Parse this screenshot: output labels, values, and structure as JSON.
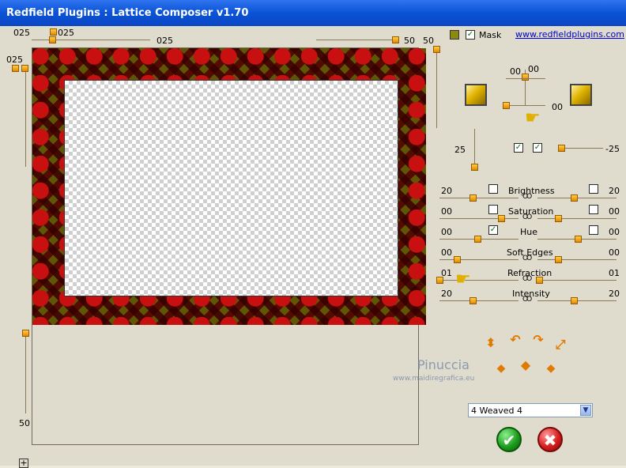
{
  "window": {
    "title": "Redfield Plugins : Lattice Composer v1.70"
  },
  "top_sliders": {
    "left_value": "025",
    "thumb_value": "025",
    "mid_value": "025",
    "right_value": "50",
    "right_value2": "50"
  },
  "left_sliders": {
    "top_value": "025",
    "bottom_value": "50"
  },
  "mask": {
    "label": "Mask",
    "checked": "✓"
  },
  "link": "www.redfieldplugins.com",
  "light": {
    "value_top_a": "00",
    "value_top_b": "00",
    "value_right": "00"
  },
  "side_slider": {
    "value_left": "25",
    "value_right": "-25"
  },
  "adjustments": [
    {
      "name": "Brightness",
      "left": "20",
      "right": "20"
    },
    {
      "name": "Saturation",
      "left": "00",
      "right": "00"
    },
    {
      "name": "Hue",
      "left": "00",
      "right": "00"
    },
    {
      "name": "Soft Edges",
      "left": "00",
      "right": "00"
    },
    {
      "name": "Refraction",
      "left": "01",
      "right": "01"
    },
    {
      "name": "Intensity",
      "left": "20",
      "right": "20"
    }
  ],
  "link_symbol": "Ꝏ",
  "preset": {
    "selected": "4 Weaved 4"
  },
  "buttons": {
    "ok": "✔",
    "cancel": "✖"
  },
  "watermark": {
    "name": "Pinuccia",
    "site": "www.maidiregrafica.eu"
  },
  "icons": {
    "check": "✓",
    "arrow": "▼",
    "plus": "+",
    "hand": "☛"
  },
  "colors": {
    "title_bar": "#0a53d6",
    "accent": "#e08a00"
  }
}
